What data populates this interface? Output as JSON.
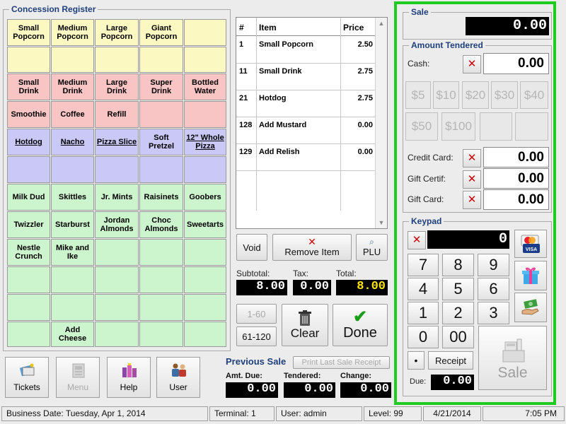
{
  "register": {
    "title": "Concession Register",
    "products": [
      [
        {
          "label": "Small Popcorn",
          "c": "y"
        },
        {
          "label": "Medium Popcorn",
          "c": "y"
        },
        {
          "label": "Large Popcorn",
          "c": "y"
        },
        {
          "label": "Giant Popcorn",
          "c": "y"
        },
        {
          "label": "",
          "c": "y"
        }
      ],
      [
        {
          "label": "",
          "c": "y"
        },
        {
          "label": "",
          "c": "y"
        },
        {
          "label": "",
          "c": "y"
        },
        {
          "label": "",
          "c": "y"
        },
        {
          "label": "",
          "c": "y"
        }
      ],
      [
        {
          "label": "Small Drink",
          "c": "r"
        },
        {
          "label": "Medium Drink",
          "c": "r"
        },
        {
          "label": "Large Drink",
          "c": "r"
        },
        {
          "label": "Super Drink",
          "c": "r"
        },
        {
          "label": "Bottled Water",
          "c": "r"
        }
      ],
      [
        {
          "label": "Smoothie",
          "c": "r"
        },
        {
          "label": "Coffee",
          "c": "r"
        },
        {
          "label": "Refill",
          "c": "r"
        },
        {
          "label": "",
          "c": "r"
        },
        {
          "label": "",
          "c": "r"
        }
      ],
      [
        {
          "label": "Hotdog",
          "c": "b",
          "u": true
        },
        {
          "label": "Nacho",
          "c": "b",
          "u": true
        },
        {
          "label": "Pizza Slice",
          "c": "b",
          "u": true
        },
        {
          "label": "Soft Pretzel",
          "c": "b"
        },
        {
          "label": "12\" Whole Pizza",
          "c": "b",
          "u": true
        }
      ],
      [
        {
          "label": "",
          "c": "b"
        },
        {
          "label": "",
          "c": "b"
        },
        {
          "label": "",
          "c": "b"
        },
        {
          "label": "",
          "c": "b"
        },
        {
          "label": "",
          "c": "b"
        }
      ],
      [
        {
          "label": "Milk Dud",
          "c": "g"
        },
        {
          "label": "Skittles",
          "c": "g"
        },
        {
          "label": "Jr. Mints",
          "c": "g"
        },
        {
          "label": "Raisinets",
          "c": "g"
        },
        {
          "label": "Goobers",
          "c": "g"
        }
      ],
      [
        {
          "label": "Twizzler",
          "c": "g"
        },
        {
          "label": "Starburst",
          "c": "g"
        },
        {
          "label": "Jordan Almonds",
          "c": "g"
        },
        {
          "label": "Choc Almonds",
          "c": "g"
        },
        {
          "label": "Sweetarts",
          "c": "g"
        }
      ],
      [
        {
          "label": "Nestle Crunch",
          "c": "g"
        },
        {
          "label": "Mike and Ike",
          "c": "g"
        },
        {
          "label": "",
          "c": "g"
        },
        {
          "label": "",
          "c": "g"
        },
        {
          "label": "",
          "c": "g"
        }
      ],
      [
        {
          "label": "",
          "c": "g"
        },
        {
          "label": "",
          "c": "g"
        },
        {
          "label": "",
          "c": "g"
        },
        {
          "label": "",
          "c": "g"
        },
        {
          "label": "",
          "c": "g"
        }
      ],
      [
        {
          "label": "",
          "c": "g"
        },
        {
          "label": "",
          "c": "g"
        },
        {
          "label": "",
          "c": "g"
        },
        {
          "label": "",
          "c": "g"
        },
        {
          "label": "",
          "c": "g"
        }
      ],
      [
        {
          "label": "",
          "c": "g"
        },
        {
          "label": "Add Cheese",
          "c": "g"
        },
        {
          "label": "",
          "c": "g"
        },
        {
          "label": "",
          "c": "g"
        },
        {
          "label": "",
          "c": "g"
        }
      ]
    ]
  },
  "items": {
    "headers": {
      "num": "#",
      "item": "Item",
      "price": "Price"
    },
    "rows": [
      {
        "num": "1",
        "item": "Small Popcorn",
        "price": "2.50"
      },
      {
        "num": "11",
        "item": "Small Drink",
        "price": "2.75"
      },
      {
        "num": "21",
        "item": "Hotdog",
        "price": "2.75"
      },
      {
        "num": "128",
        "item": "Add Mustard",
        "price": "0.00"
      },
      {
        "num": "129",
        "item": "Add Relish",
        "price": "0.00"
      }
    ]
  },
  "actions": {
    "void": "Void",
    "remove_item": "Remove Item",
    "plu": "PLU",
    "range1": "1-60",
    "range2": "61-120",
    "clear": "Clear",
    "done": "Done"
  },
  "totals": {
    "subtotal_label": "Subtotal:",
    "tax_label": "Tax:",
    "total_label": "Total:",
    "subtotal": "8.00",
    "tax": "0.00",
    "total": "8.00"
  },
  "previous_sale": {
    "title": "Previous Sale",
    "print_label": "Print Last Sale Receipt",
    "amt_due_label": "Amt. Due:",
    "tendered_label": "Tendered:",
    "change_label": "Change:",
    "amt_due": "0.00",
    "tendered": "0.00",
    "change": "0.00"
  },
  "bottom_buttons": {
    "tickets": "Tickets",
    "menu": "Menu",
    "help": "Help",
    "user": "User"
  },
  "sale": {
    "title": "Sale",
    "amount": "0.00"
  },
  "tendered": {
    "title": "Amount Tendered",
    "cash_label": "Cash:",
    "cash": "0.00",
    "money_buttons": [
      "$5",
      "$10",
      "$20",
      "$30",
      "$40",
      "$50",
      "$100"
    ],
    "credit_label": "Credit Card:",
    "credit": "0.00",
    "gift_certif_label": "Gift Certif:",
    "gift_certif": "0.00",
    "gift_card_label": "Gift Card:",
    "gift_card": "0.00"
  },
  "keypad": {
    "title": "Keypad",
    "display": "0",
    "keys": [
      "7",
      "8",
      "9",
      "4",
      "5",
      "6",
      "1",
      "2",
      "3",
      "0",
      "00"
    ],
    "dot": "•",
    "receipt": "Receipt",
    "due_label": "Due:",
    "due": "0.00",
    "sale_button": "Sale"
  },
  "status": {
    "business_date": "Business Date:  Tuesday,  Apr 1, 2014",
    "terminal": "Terminal:  1",
    "user": "User:  admin",
    "level": "Level:  99",
    "date": "4/21/2014",
    "time": "7:05 PM"
  },
  "colors": {
    "accent_green": "#1fcb1f",
    "title_blue": "#1f3f7a",
    "cancel_red": "#cc0000"
  }
}
